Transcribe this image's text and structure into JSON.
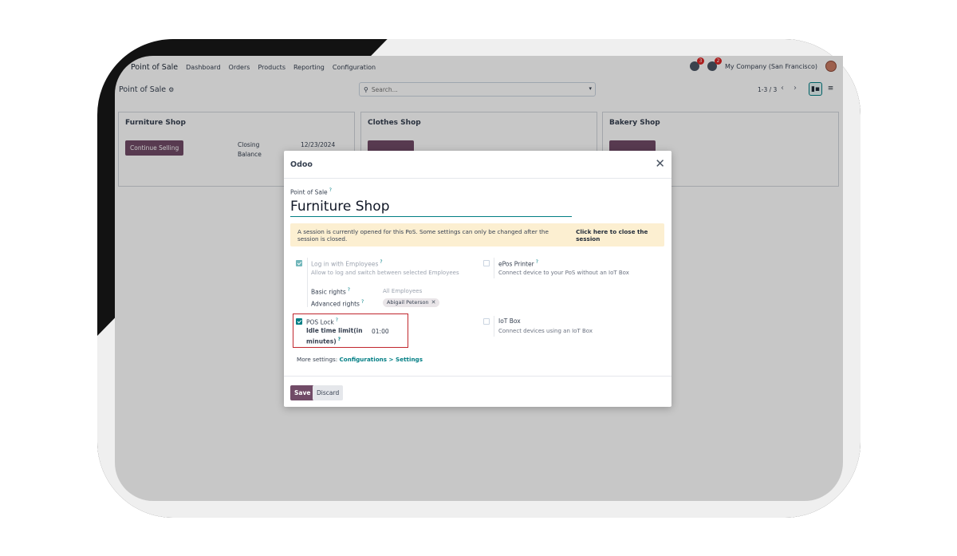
{
  "navbar": {
    "brand": "Point of Sale",
    "menu": [
      "Dashboard",
      "Orders",
      "Products",
      "Reporting",
      "Configuration"
    ],
    "messages_badge": "3",
    "activities_badge": "2",
    "company": "My Company (San Francisco)"
  },
  "control_panel": {
    "title": "Point of Sale",
    "search_placeholder": "Search...",
    "pager": "1-3 / 3"
  },
  "cards": [
    {
      "title": "Furniture Shop",
      "button": "Continue Selling",
      "info_label_1": "Closing",
      "info_label_2": "Balance",
      "info_value": "12/23/2024"
    },
    {
      "title": "Clothes Shop"
    },
    {
      "title": "Bakery Shop"
    }
  ],
  "modal": {
    "title": "Odoo",
    "field_label": "Point of Sale",
    "help_mark": "?",
    "name_value": "Furniture Shop",
    "alert_text": "A session is currently opened for this PoS. Some settings can only be changed after the session is closed.",
    "alert_link": "Click here to close the session",
    "settings": {
      "login_employees": {
        "title": "Log in with Employees",
        "desc": "Allow to log and switch between selected Employees",
        "basic_rights_label": "Basic rights",
        "basic_rights_value": "All Employees",
        "advanced_rights_label": "Advanced rights",
        "advanced_rights_tag": "Abigail Peterson",
        "checked": true
      },
      "epos_printer": {
        "title": "ePos Printer",
        "desc": "Connect device to your PoS without an IoT Box",
        "checked": false
      },
      "pos_lock": {
        "title": "POS Lock",
        "idle_label_1": "Idle time limit(in",
        "idle_label_2": "minutes)",
        "idle_value": "01:00",
        "checked": true
      },
      "iot_box": {
        "title": "IoT Box",
        "desc": "Connect devices using an IoT Box",
        "checked": false
      }
    },
    "more_settings_label": "More settings:",
    "more_settings_link": "Configurations > Settings",
    "save_label": "Save",
    "discard_label": "Discard"
  },
  "colors": {
    "primary": "#714b67",
    "accent": "#017e84",
    "alert_bg": "#fcefd1",
    "highlight": "#c0262d"
  }
}
